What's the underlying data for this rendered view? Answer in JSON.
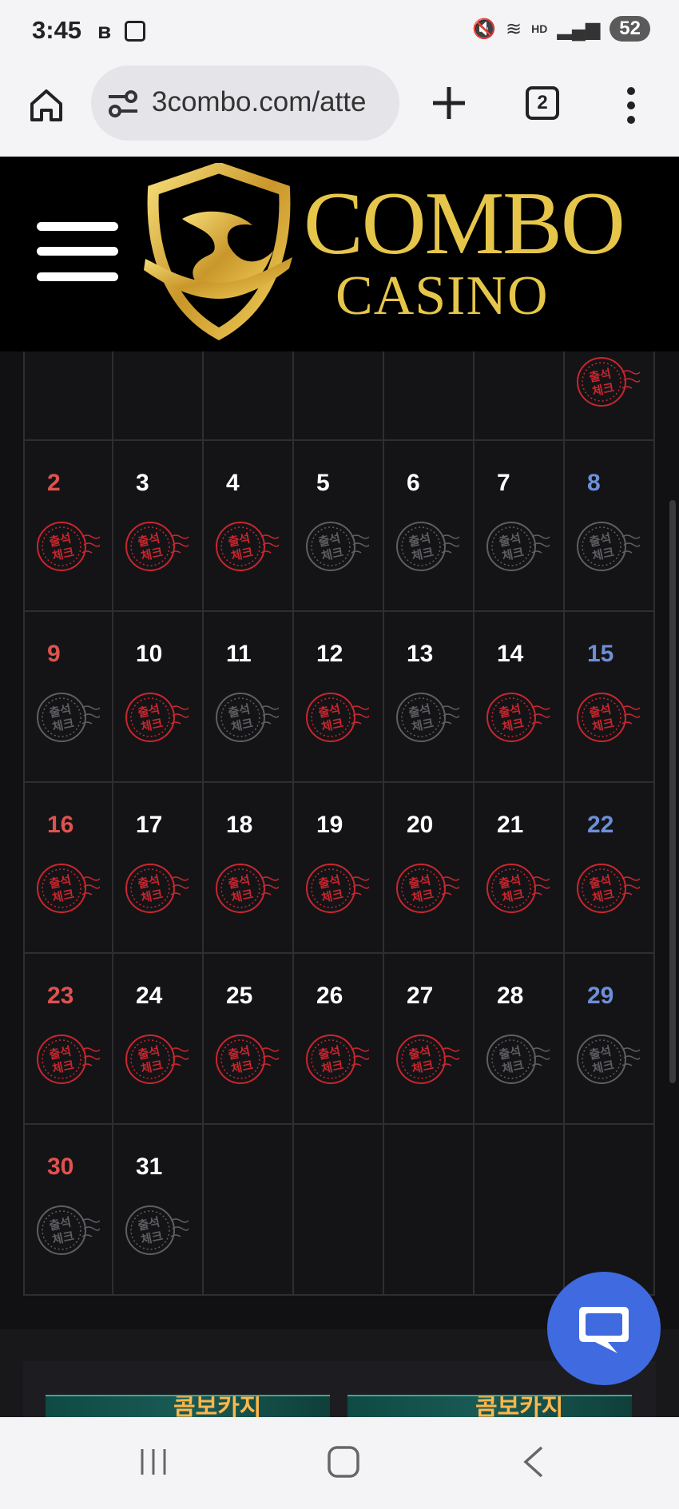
{
  "status_bar": {
    "time": "3:45",
    "battery": "52"
  },
  "browser": {
    "url": "3combo.com/atte",
    "tab_count": "2"
  },
  "site": {
    "logo_line1": "COMBO",
    "logo_line2": "CASINO"
  },
  "calendar": {
    "stamp_text_top": "출석",
    "stamp_text_bottom": "체크",
    "first_row": [
      {
        "day": "",
        "checked": null
      },
      {
        "day": "",
        "checked": null
      },
      {
        "day": "",
        "checked": null
      },
      {
        "day": "",
        "checked": null
      },
      {
        "day": "",
        "checked": null
      },
      {
        "day": "",
        "checked": null
      },
      {
        "day": "",
        "checked": true
      }
    ],
    "weeks": [
      [
        {
          "day": "2",
          "checked": true
        },
        {
          "day": "3",
          "checked": true
        },
        {
          "day": "4",
          "checked": true
        },
        {
          "day": "5",
          "checked": false
        },
        {
          "day": "6",
          "checked": false
        },
        {
          "day": "7",
          "checked": false
        },
        {
          "day": "8",
          "checked": false
        }
      ],
      [
        {
          "day": "9",
          "checked": false
        },
        {
          "day": "10",
          "checked": true
        },
        {
          "day": "11",
          "checked": false
        },
        {
          "day": "12",
          "checked": true
        },
        {
          "day": "13",
          "checked": false
        },
        {
          "day": "14",
          "checked": true
        },
        {
          "day": "15",
          "checked": true
        }
      ],
      [
        {
          "day": "16",
          "checked": true
        },
        {
          "day": "17",
          "checked": true
        },
        {
          "day": "18",
          "checked": true
        },
        {
          "day": "19",
          "checked": true
        },
        {
          "day": "20",
          "checked": true
        },
        {
          "day": "21",
          "checked": true
        },
        {
          "day": "22",
          "checked": true
        }
      ],
      [
        {
          "day": "23",
          "checked": true
        },
        {
          "day": "24",
          "checked": true
        },
        {
          "day": "25",
          "checked": true
        },
        {
          "day": "26",
          "checked": true
        },
        {
          "day": "27",
          "checked": true
        },
        {
          "day": "28",
          "checked": false
        },
        {
          "day": "29",
          "checked": false
        }
      ],
      [
        {
          "day": "30",
          "checked": false
        },
        {
          "day": "31",
          "checked": false
        },
        {
          "day": "",
          "checked": null
        },
        {
          "day": "",
          "checked": null
        },
        {
          "day": "",
          "checked": null
        },
        {
          "day": "",
          "checked": null
        },
        {
          "day": "",
          "checked": null
        }
      ]
    ]
  },
  "banners": [
    {
      "label": "콤보카지"
    },
    {
      "label": "콤보카지"
    }
  ],
  "colors": {
    "checked": "#c8262e",
    "unchecked": "#5e5e62",
    "sunday": "#e0524e",
    "saturday": "#6d8fd8",
    "chat": "#3f6ae0",
    "logo_gold": "#e6c64a"
  }
}
